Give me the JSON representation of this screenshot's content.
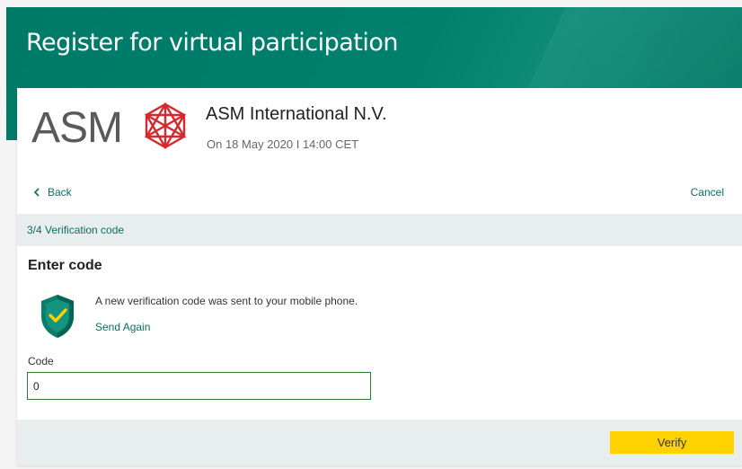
{
  "header": {
    "title": "Register for virtual participation"
  },
  "company": {
    "logo_text": "ASM",
    "name": "ASM International N.V.",
    "date": "On 18 May 2020 I 14:00 CET"
  },
  "nav": {
    "back_label": "Back",
    "cancel_label": "Cancel"
  },
  "step": {
    "label": "3/4 Verification code"
  },
  "form": {
    "section_title": "Enter code",
    "notice_text": "A new verification code was sent to your mobile phone.",
    "send_again_label": "Send Again",
    "code_label": "Code",
    "code_value": "0",
    "verify_label": "Verify"
  },
  "icons": {
    "shield": "shield-check-icon",
    "back": "chevron-left-icon",
    "logo": "asm-logo-icon"
  },
  "colors": {
    "brand_green": "#007a68",
    "link_green": "#0a6f60",
    "verify_yellow": "#ffd200",
    "logo_red": "#d7282f",
    "logo_gray": "#5a5a5a"
  }
}
